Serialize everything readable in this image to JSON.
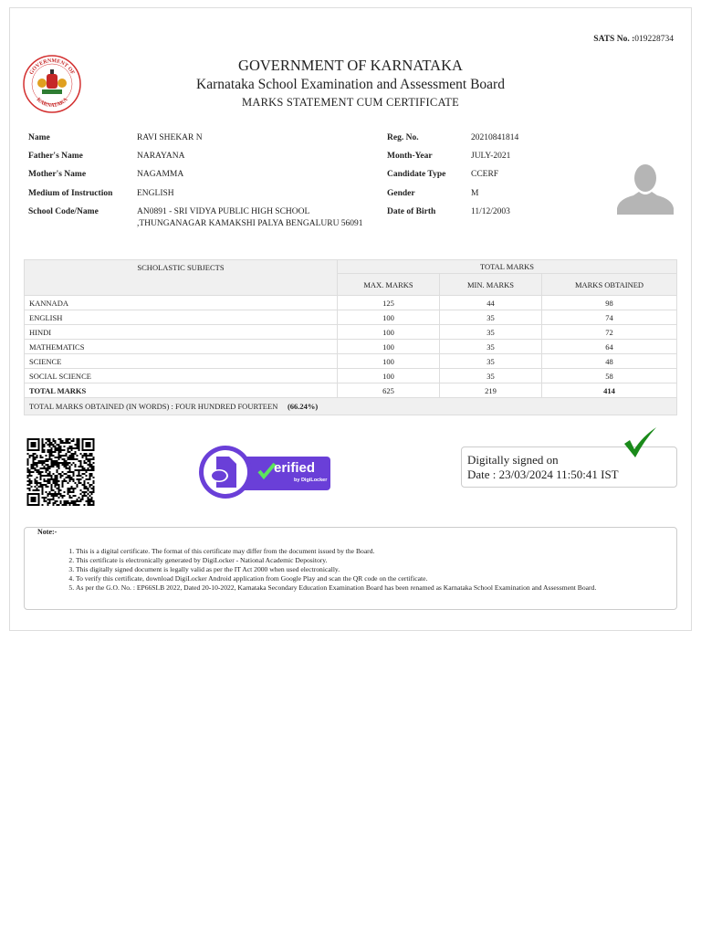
{
  "header": {
    "sats_label": "SATS No. :",
    "sats_no": "019228734",
    "logo_text_top": "GOVERNMENT OF",
    "logo_text_bottom": "KARNATAKA",
    "title": "GOVERNMENT OF KARNATAKA",
    "board": "Karnataka School Examination and Assessment Board",
    "subtitle": "MARKS STATEMENT CUM CERTIFICATE"
  },
  "candidate": {
    "left": [
      {
        "label": "Name",
        "value": "RAVI SHEKAR N"
      },
      {
        "label": "Father's Name",
        "value": "NARAYANA"
      },
      {
        "label": "Mother's Name",
        "value": "NAGAMMA"
      },
      {
        "label": "Medium of Instruction",
        "value": "ENGLISH"
      },
      {
        "label": "School Code/Name",
        "value": "AN0891 - SRI VIDYA PUBLIC HIGH SCHOOL ,THUNGANAGAR KAMAKSHI PALYA BENGALURU 56091"
      }
    ],
    "right": [
      {
        "label": "Reg. No.",
        "value": "20210841814"
      },
      {
        "label": "Month-Year",
        "value": "JULY-2021"
      },
      {
        "label": "Candidate Type",
        "value": "CCERF"
      },
      {
        "label": "Gender",
        "value": "M"
      },
      {
        "label": "Date of Birth",
        "value": "11/12/2003"
      }
    ]
  },
  "marks": {
    "headers": {
      "subjects": "SCHOLASTIC SUBJECTS",
      "total": "TOTAL MARKS",
      "max": "MAX. MARKS",
      "min": "MIN. MARKS",
      "obtained": "MARKS OBTAINED"
    },
    "rows": [
      {
        "subject": "KANNADA",
        "max": "125",
        "min": "44",
        "obtained": "98"
      },
      {
        "subject": "ENGLISH",
        "max": "100",
        "min": "35",
        "obtained": "74"
      },
      {
        "subject": "HINDI",
        "max": "100",
        "min": "35",
        "obtained": "72"
      },
      {
        "subject": "MATHEMATICS",
        "max": "100",
        "min": "35",
        "obtained": "64"
      },
      {
        "subject": "SCIENCE",
        "max": "100",
        "min": "35",
        "obtained": "48"
      },
      {
        "subject": "SOCIAL SCIENCE",
        "max": "100",
        "min": "35",
        "obtained": "58"
      }
    ],
    "total": {
      "subject": "TOTAL MARKS",
      "max": "625",
      "min": "219",
      "obtained": "414"
    },
    "words": "TOTAL MARKS OBTAINED (IN WORDS) : FOUR HUNDRED FOURTEEN",
    "percent": "(66.24%)"
  },
  "verification": {
    "badge_text": "erified",
    "badge_sub": "by DigiLocker",
    "signed_line1": "Digitally signed on",
    "signed_line2": "Date : 23/03/2024 11:50:41 IST"
  },
  "note": {
    "title": "Note:-",
    "items": [
      "This is a digital certificate. The format of this certificate may differ from the document issued by the Board.",
      "This certificate is electronically generated by DigiLocker - National Academic Depository.",
      "This digitally signed document is legally valid as per the IT Act 2000 when used electronically.",
      "To verify this certificate, download DigiLocker Android application from Google Play and scan the QR code on the certificate.",
      "As per the G.O. No. : EP66SLB 2022, Dated 20-10-2022, Karnataka Secondary Education Examination Board has been renamed as Karnataka School Examination and Assessment Board."
    ]
  },
  "colors": {
    "seal": "#d32f2f",
    "badge": "#6a3fd8",
    "check": "#1a8a1a"
  }
}
